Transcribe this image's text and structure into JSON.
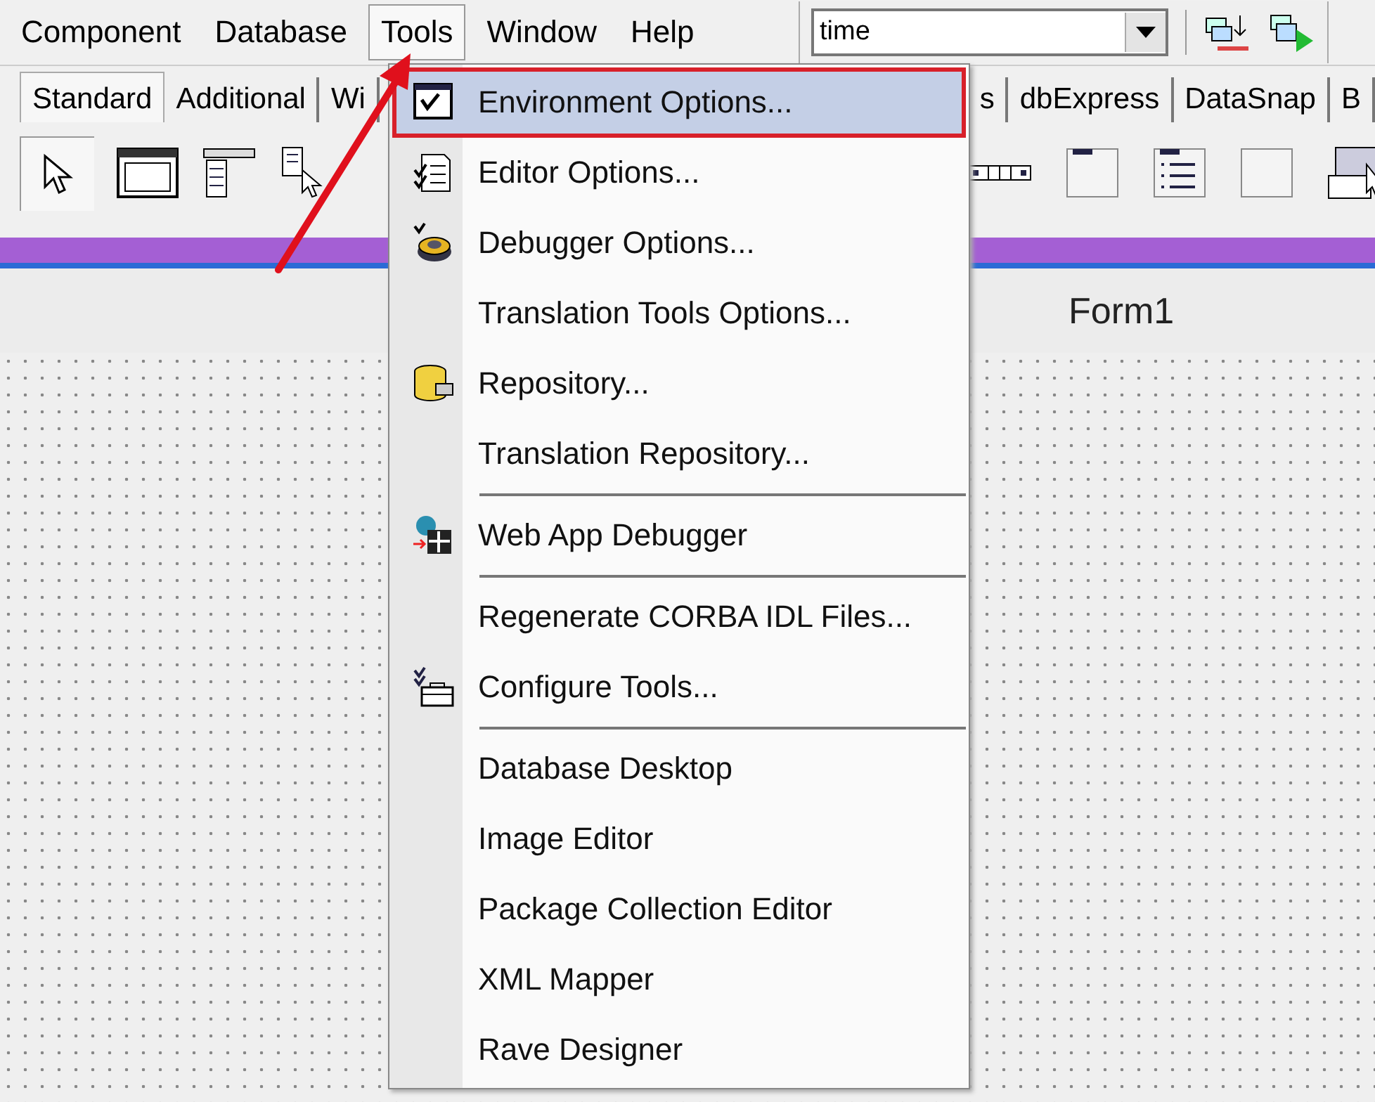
{
  "menu_bar": [
    {
      "label": "Component",
      "selected": false
    },
    {
      "label": "Database",
      "selected": false
    },
    {
      "label": "Tools",
      "selected": true
    },
    {
      "label": "Window",
      "selected": false
    },
    {
      "label": "Help",
      "selected": false
    }
  ],
  "toolbar": {
    "combo_value": "time"
  },
  "palette_tabs_left": [
    {
      "label": "Standard",
      "selected": true
    },
    {
      "label": "Additional",
      "selected": false
    },
    {
      "label": "Wi",
      "selected": false
    }
  ],
  "palette_tabs_right": [
    {
      "label": "s",
      "selected": false
    },
    {
      "label": "dbExpress",
      "selected": false
    },
    {
      "label": "DataSnap",
      "selected": false
    },
    {
      "label": "B",
      "selected": false
    }
  ],
  "form": {
    "title": "Form1"
  },
  "tools_menu": [
    {
      "kind": "item",
      "label": "Environment Options...",
      "selected": true
    },
    {
      "kind": "item",
      "label": "Editor Options...",
      "selected": false
    },
    {
      "kind": "item",
      "label": "Debugger Options...",
      "selected": false
    },
    {
      "kind": "item",
      "label": "Translation Tools Options...",
      "selected": false
    },
    {
      "kind": "item",
      "label": "Repository...",
      "selected": false
    },
    {
      "kind": "item",
      "label": "Translation Repository...",
      "selected": false
    },
    {
      "kind": "separator"
    },
    {
      "kind": "item",
      "label": "Web App Debugger",
      "selected": false
    },
    {
      "kind": "separator"
    },
    {
      "kind": "item",
      "label": "Regenerate CORBA IDL Files...",
      "selected": false
    },
    {
      "kind": "item",
      "label": "Configure Tools...",
      "selected": false
    },
    {
      "kind": "separator"
    },
    {
      "kind": "item",
      "label": "Database Desktop",
      "selected": false
    },
    {
      "kind": "item",
      "label": "Image Editor",
      "selected": false
    },
    {
      "kind": "item",
      "label": "Package Collection Editor",
      "selected": false
    },
    {
      "kind": "item",
      "label": "XML Mapper",
      "selected": false
    },
    {
      "kind": "item",
      "label": "Rave Designer",
      "selected": false
    }
  ]
}
